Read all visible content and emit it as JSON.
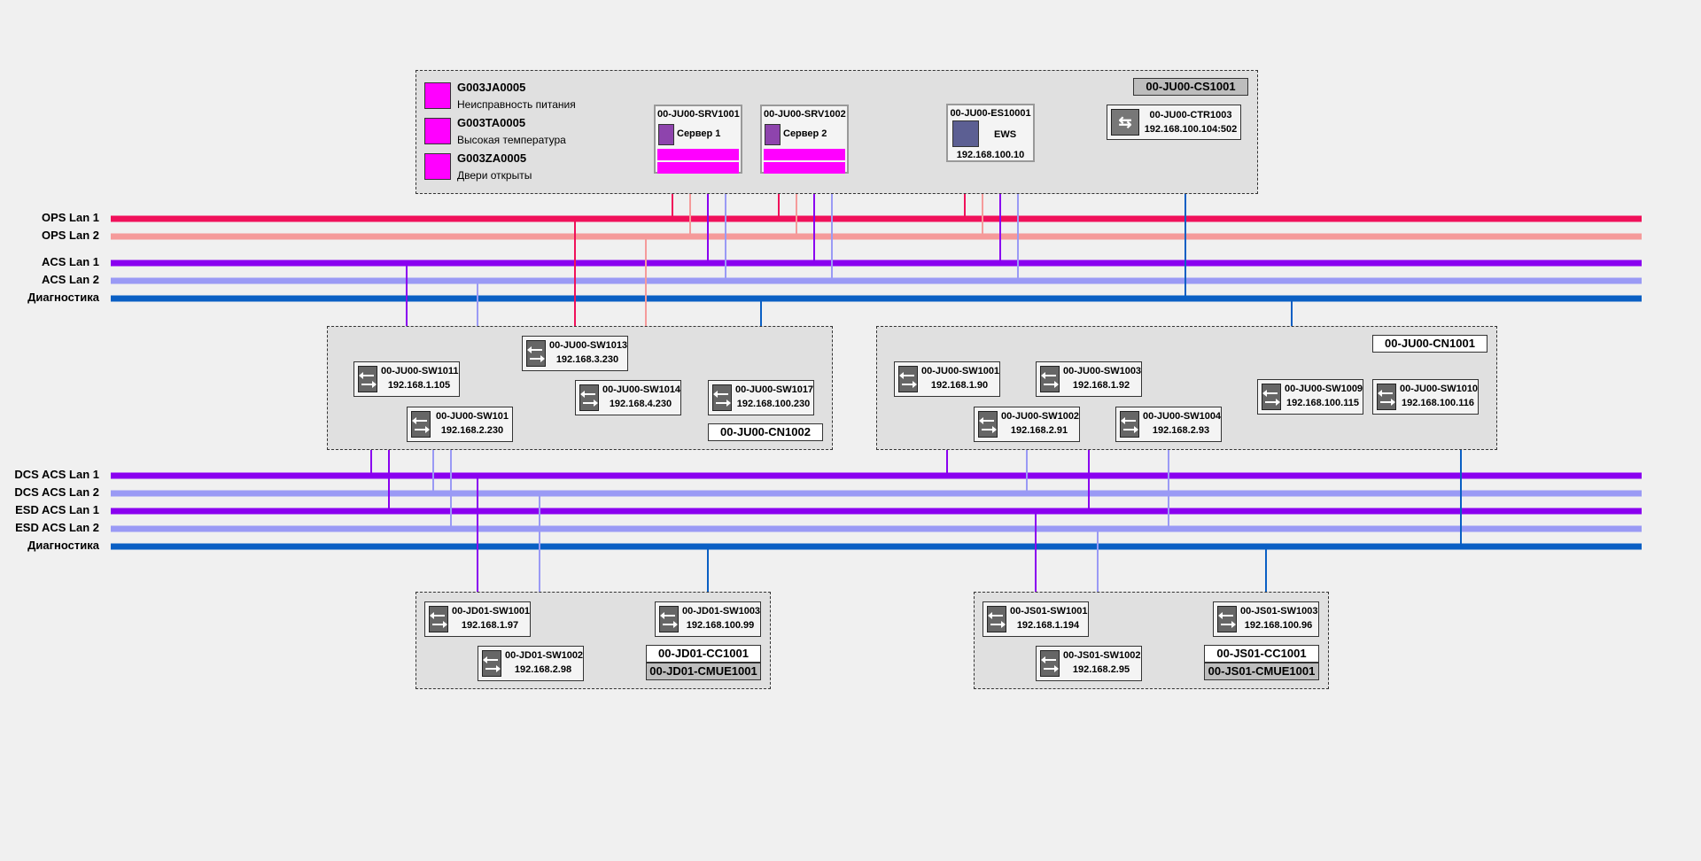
{
  "buses": {
    "ops_lan1": "OPS Lan 1",
    "ops_lan2": "OPS Lan 2",
    "acs_lan1": "ACS Lan 1",
    "acs_lan2": "ACS Lan 2",
    "diag1": "Диагностика",
    "dcs_lan1": "DCS ACS Lan 1",
    "dcs_lan2": "DCS ACS Lan 2",
    "esd_lan1": "ESD ACS Lan 1",
    "esd_lan2": "ESD ACS Lan 2",
    "diag2": "Диагностика"
  },
  "colors": {
    "ops_lan1": "#f0105a",
    "ops_lan2": "#f59a9a",
    "acs_lan1": "#8a00f0",
    "acs_lan2": "#9a9af5",
    "diag": "#0a5fc4",
    "alarm": "#ff00ff"
  },
  "cs": {
    "title": "00-JU00-CS1001",
    "legend": [
      {
        "code": "G003JA0005",
        "text": "Неисправность питания"
      },
      {
        "code": "G003TA0005",
        "text": "Высокая температура"
      },
      {
        "code": "G003ZA0005",
        "text": "Двери открыты"
      }
    ],
    "srv1": {
      "name": "00-JU00-SRV1001",
      "sub": "Сервер 1"
    },
    "srv2": {
      "name": "00-JU00-SRV1002",
      "sub": "Сервер 2"
    },
    "ews": {
      "name": "00-JU00-ES10001",
      "sub": "EWS",
      "ip": "192.168.100.10"
    },
    "ctr": {
      "name": "00-JU00-CTR1003",
      "ip": "192.168.100.104:502"
    }
  },
  "cn1002": {
    "title": "00-JU00-CN1002",
    "sw1011": {
      "name": "00-JU00-SW1011",
      "ip": "192.168.1.105"
    },
    "sw101": {
      "name": "00-JU00-SW101",
      "ip": "192.168.2.230"
    },
    "sw1013": {
      "name": "00-JU00-SW1013",
      "ip": "192.168.3.230"
    },
    "sw1014": {
      "name": "00-JU00-SW1014",
      "ip": "192.168.4.230"
    },
    "sw1017": {
      "name": "00-JU00-SW1017",
      "ip": "192.168.100.230"
    }
  },
  "cn1001": {
    "title": "00-JU00-CN1001",
    "sw1001": {
      "name": "00-JU00-SW1001",
      "ip": "192.168.1.90"
    },
    "sw1002": {
      "name": "00-JU00-SW1002",
      "ip": "192.168.2.91"
    },
    "sw1003": {
      "name": "00-JU00-SW1003",
      "ip": "192.168.1.92"
    },
    "sw1004": {
      "name": "00-JU00-SW1004",
      "ip": "192.168.2.93"
    },
    "sw1009": {
      "name": "00-JU00-SW1009",
      "ip": "192.168.100.115"
    },
    "sw1010": {
      "name": "00-JU00-SW1010",
      "ip": "192.168.100.116"
    }
  },
  "jd01": {
    "title": "00-JD01-CC1001",
    "subtitle": "00-JD01-CMUE1001",
    "sw1001": {
      "name": "00-JD01-SW1001",
      "ip": "192.168.1.97"
    },
    "sw1002": {
      "name": "00-JD01-SW1002",
      "ip": "192.168.2.98"
    },
    "sw1003": {
      "name": "00-JD01-SW1003",
      "ip": "192.168.100.99"
    }
  },
  "js01": {
    "title": "00-JS01-CC1001",
    "subtitle": "00-JS01-CMUE1001",
    "sw1001": {
      "name": "00-JS01-SW1001",
      "ip": "192.168.1.194"
    },
    "sw1002": {
      "name": "00-JS01-SW1002",
      "ip": "192.168.2.95"
    },
    "sw1003": {
      "name": "00-JS01-SW1003",
      "ip": "192.168.100.96"
    }
  }
}
